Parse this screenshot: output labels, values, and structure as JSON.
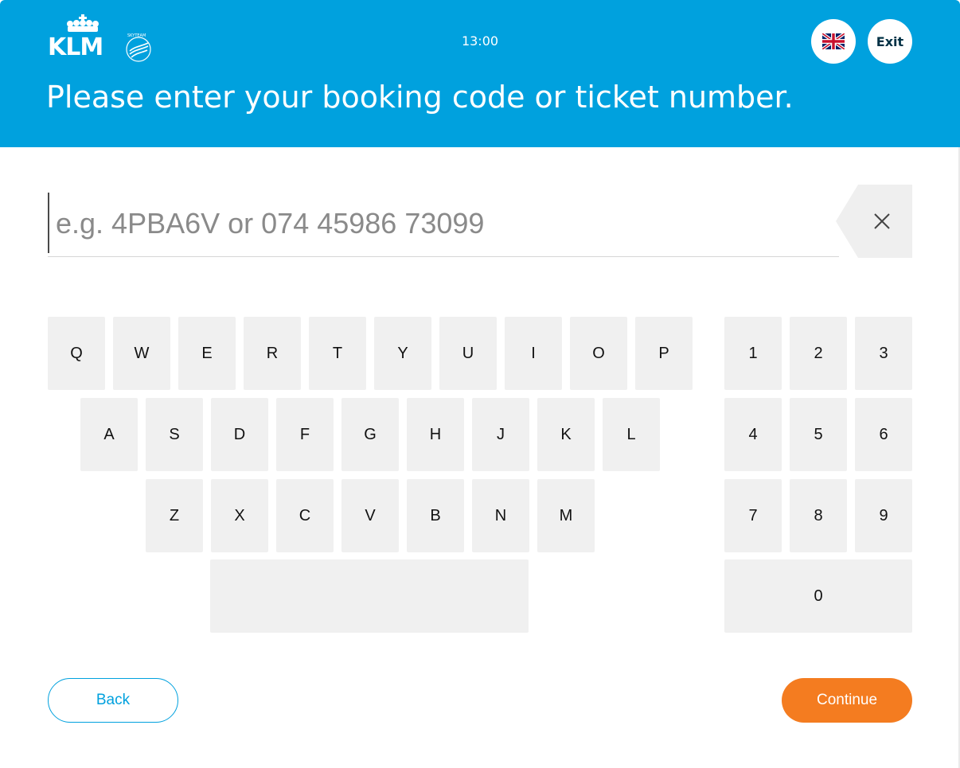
{
  "header": {
    "logo_text": "KLM",
    "logo_alliance": "SKYTEAM",
    "time": "13:00",
    "language_icon": "uk-flag-icon",
    "exit_label": "Exit",
    "prompt": "Please enter your booking code or ticket number.",
    "background_color": "#00a1de"
  },
  "input": {
    "value": "",
    "placeholder": "e.g. 4PBA6V or 074 45986 73099",
    "clear_icon": "close-icon"
  },
  "keyboard": {
    "row1": [
      "Q",
      "W",
      "E",
      "R",
      "T",
      "Y",
      "U",
      "I",
      "O",
      "P"
    ],
    "row2": [
      "A",
      "S",
      "D",
      "F",
      "G",
      "H",
      "J",
      "K",
      "L"
    ],
    "row3": [
      "Z",
      "X",
      "C",
      "V",
      "B",
      "N",
      "M"
    ],
    "space_label": "",
    "numpad": [
      "1",
      "2",
      "3",
      "4",
      "5",
      "6",
      "7",
      "8",
      "9",
      "0"
    ]
  },
  "footer": {
    "back_label": "Back",
    "continue_label": "Continue",
    "accent_color": "#f47c20",
    "secondary_color": "#00a1de"
  }
}
